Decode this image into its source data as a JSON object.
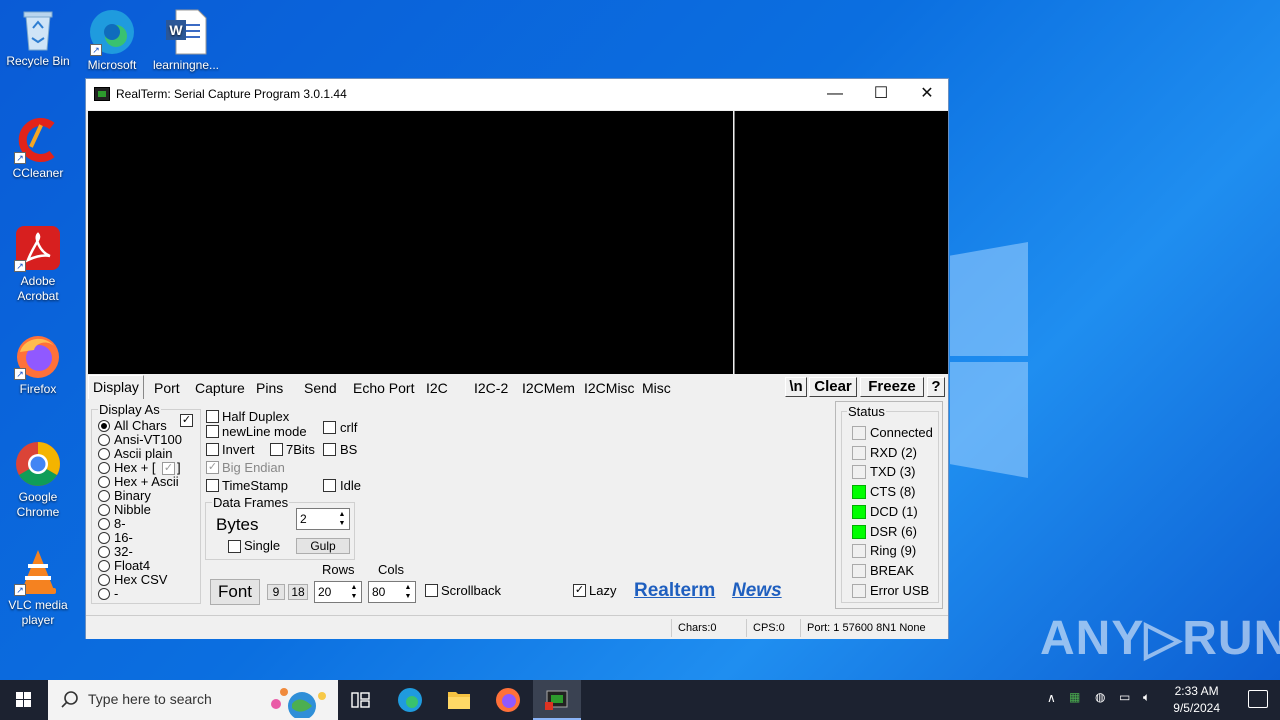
{
  "desktop": {
    "icons": [
      {
        "label": "Recycle Bin"
      },
      {
        "label": "Microsoft Ed..."
      },
      {
        "label": "learningne..."
      },
      {
        "label": "CCleaner"
      },
      {
        "label": "Adobe Acrobat"
      },
      {
        "label": "Firefox"
      },
      {
        "label": "Google Chrome"
      },
      {
        "label": "VLC media player"
      }
    ]
  },
  "window": {
    "title": "RealTerm: Serial Capture Program 3.0.1.44",
    "minimize": "—",
    "maximize": "☐",
    "close": "✕"
  },
  "tabs": [
    "Display",
    "Port",
    "Capture",
    "Pins",
    "Send",
    "Echo Port",
    "I2C",
    "I2C-2",
    "I2CMem",
    "I2CMisc",
    "Misc"
  ],
  "toolbar": {
    "newline": "\\n",
    "clear": "Clear",
    "freeze": "Freeze",
    "help": "?"
  },
  "display_as": {
    "title": "Display As",
    "options": [
      "All Chars",
      "Ansi-VT100",
      "Ascii plain",
      "Hex + [",
      "Hex + Ascii",
      "Binary",
      "Nibble",
      "8-",
      "16-",
      "32-",
      "Float4",
      "Hex CSV",
      "-"
    ],
    "selected": "All Chars",
    "hex_suffix": "]"
  },
  "options": {
    "half_duplex": "Half Duplex",
    "crlf": "crlf",
    "newline_mode": "newLine mode",
    "invert": "Invert",
    "seven_bits": "7Bits",
    "bs": "BS",
    "big_endian": "Big Endian",
    "timestamp": "TimeStamp",
    "idle": "Idle"
  },
  "data_frames": {
    "title": "Data Frames",
    "label": "Bytes",
    "value": "2",
    "single": "Single",
    "gulp": "Gulp"
  },
  "bottom": {
    "font": "Font",
    "size_9": "9",
    "size_18": "18",
    "rows_label": "Rows",
    "rows_value": "20",
    "cols_label": "Cols",
    "cols_value": "80",
    "scrollback": "Scrollback",
    "lazy": "Lazy",
    "realterm_link": "Realterm",
    "news_link": "News"
  },
  "status": {
    "title": "Status",
    "items": [
      {
        "label": "Connected",
        "on": false
      },
      {
        "label": "RXD (2)",
        "on": false
      },
      {
        "label": "TXD (3)",
        "on": false
      },
      {
        "label": "CTS (8)",
        "on": true
      },
      {
        "label": "DCD (1)",
        "on": true
      },
      {
        "label": "DSR (6)",
        "on": true
      },
      {
        "label": "Ring (9)",
        "on": false
      },
      {
        "label": "BREAK",
        "on": false
      },
      {
        "label": "Error  USB",
        "on": false
      }
    ],
    "led_on_color": "#00ff00"
  },
  "statusbar": {
    "chars": "Chars:0",
    "cps": "CPS:0",
    "port": "Port: 1  57600 8N1 None"
  },
  "taskbar": {
    "search_placeholder": "Type here to search",
    "time": "2:33 AM",
    "date": "9/5/2024"
  },
  "watermark": "ANY▷RUN"
}
